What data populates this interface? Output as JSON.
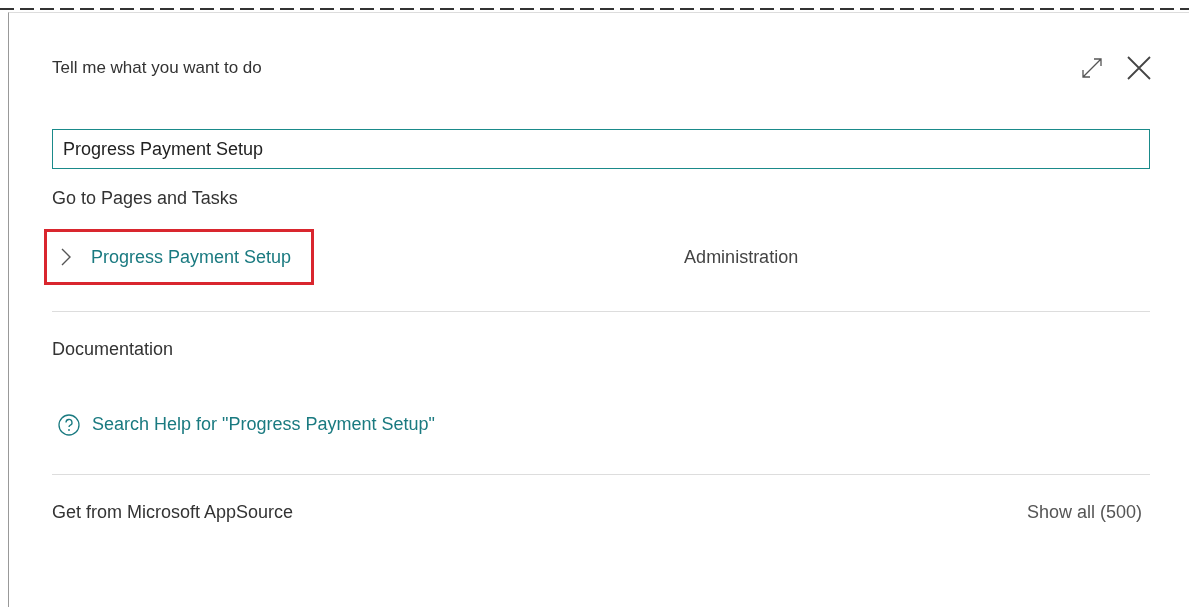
{
  "dialog": {
    "title": "Tell me what you want to do"
  },
  "search": {
    "value": "Progress Payment Setup"
  },
  "sections": [
    {
      "kind": "pages",
      "heading": "Go to Pages and Tasks",
      "items": [
        {
          "label": "Progress Payment Setup",
          "category": "Administration",
          "highlighted": true
        }
      ]
    },
    {
      "kind": "help",
      "heading": "Documentation",
      "link": "Search Help for \"Progress Payment Setup\""
    },
    {
      "kind": "appsource",
      "heading": "Get from Microsoft AppSource",
      "action": "Show all (500)"
    }
  ]
}
